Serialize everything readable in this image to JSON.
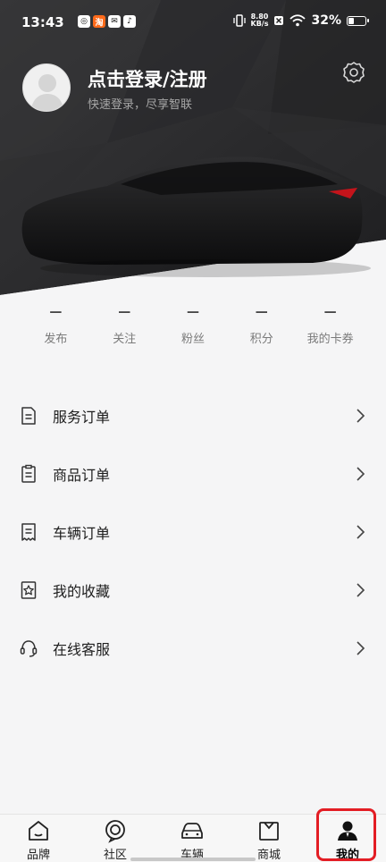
{
  "status_bar": {
    "time": "13:43",
    "app_icons": [
      "circle-app-icon",
      "orange-app-icon",
      "mail-app-icon",
      "tiktok-app-icon"
    ],
    "net_speed_value": "8.80",
    "net_speed_unit": "KB/s",
    "battery_percent": "32%",
    "battery_level": 0.32
  },
  "profile": {
    "login_title": "点击登录/注册",
    "login_subtitle": "快速登录，尽享智联"
  },
  "stats": [
    {
      "value": "—",
      "label": "发布"
    },
    {
      "value": "—",
      "label": "关注"
    },
    {
      "value": "—",
      "label": "粉丝"
    },
    {
      "value": "—",
      "label": "积分"
    },
    {
      "value": "—",
      "label": "我的卡券"
    }
  ],
  "menu": [
    {
      "label": "服务订单",
      "icon": "document-icon"
    },
    {
      "label": "商品订单",
      "icon": "clipboard-icon"
    },
    {
      "label": "车辆订单",
      "icon": "receipt-icon"
    },
    {
      "label": "我的收藏",
      "icon": "star-bookmark-icon"
    },
    {
      "label": "在线客服",
      "icon": "headset-icon"
    }
  ],
  "tabbar": [
    {
      "label": "品牌",
      "icon": "home-icon"
    },
    {
      "label": "社区",
      "icon": "community-icon"
    },
    {
      "label": "车辆",
      "icon": "car-icon"
    },
    {
      "label": "商城",
      "icon": "shopping-bag-icon"
    },
    {
      "label": "我的",
      "icon": "profile-icon",
      "active": true
    }
  ],
  "colors": {
    "hero_dark": "#2b2b2d",
    "page_bg": "#f5f5f6",
    "highlight": "#e31d24"
  }
}
